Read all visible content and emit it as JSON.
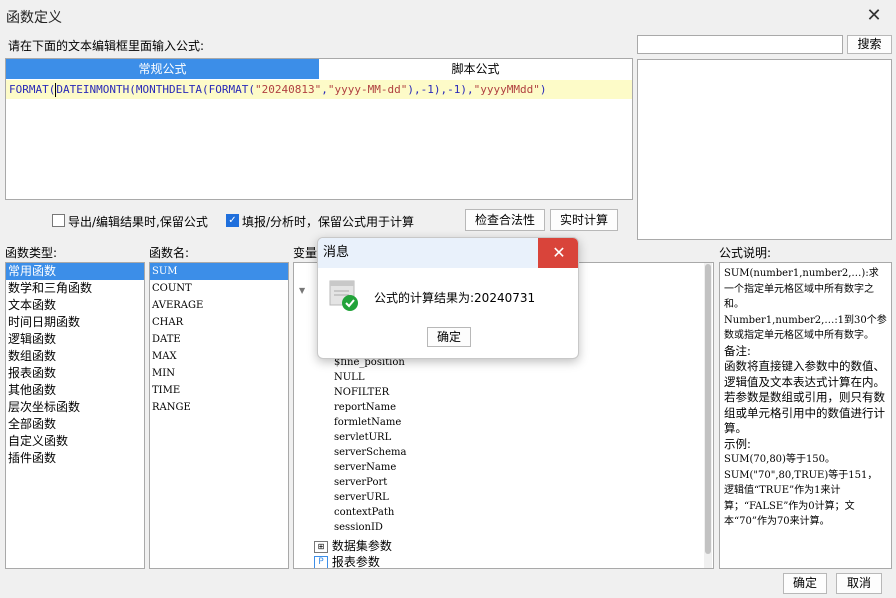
{
  "window": {
    "title": "函数定义"
  },
  "prompt": "请在下面的文本编辑框里面输入公式:",
  "search": {
    "value": "",
    "button_label": "搜索"
  },
  "editor": {
    "tabs": [
      "常规公式",
      "脚本公式"
    ],
    "formula_parts": [
      {
        "t": "FORMAT(",
        "c": "fn"
      },
      {
        "t": "DATEINMONTH(MONTHDELTA(FORMAT(",
        "c": "fn"
      },
      {
        "t": "\"20240813\"",
        "c": "str"
      },
      {
        "t": ",",
        "c": "fn"
      },
      {
        "t": "\"yyyy-MM-dd\"",
        "c": "str"
      },
      {
        "t": "),-1),-1),",
        "c": "fn"
      },
      {
        "t": "\"yyyyMMdd\"",
        "c": "str"
      },
      {
        "t": ")",
        "c": "fn"
      }
    ]
  },
  "options": {
    "export_keep": "导出/编辑结果时,保留公式",
    "fill_keep": "填报/分析时，保留公式用于计算",
    "check_button": "检查合法性",
    "realtime_button": "实时计算"
  },
  "sections": {
    "types_label": "函数类型:",
    "names_label": "函数名:",
    "vars_label": "变量",
    "desc_label": "公式说明:"
  },
  "function_types": [
    "常用函数",
    "数学和三角函数",
    "文本函数",
    "时间日期函数",
    "逻辑函数",
    "数组函数",
    "报表函数",
    "其他函数",
    "层次坐标函数",
    "全部函数",
    "自定义函数",
    "插件函数"
  ],
  "function_names": [
    "SUM",
    "COUNT",
    "AVERAGE",
    "CHAR",
    "DATE",
    "MAX",
    "MIN",
    "TIME",
    "RANGE"
  ],
  "variables": [
    "$fine_position",
    "NULL",
    "NOFILTER",
    "reportName",
    "formletName",
    "servletURL",
    "serverSchema",
    "serverName",
    "serverPort",
    "serverURL",
    "contextPath",
    "sessionID"
  ],
  "variable_nodes": [
    "数据集参数",
    "报表参数"
  ],
  "description": {
    "lines": [
      {
        "t": "SUM(number1,number2,…):求一个指定单元格区域中所有数字之和。",
        "mono": true
      },
      {
        "t": "Number1,number2,…:1到30个参数或指定单元格区域中所有数字。",
        "mono": true
      },
      {
        "t": "备注:",
        "mono": false
      },
      {
        "t": "函数将直接键入参数中的数值、逻辑值及文本表达式计算在内。若参数是数组或引用，则只有数组或单元格引用中的数值进行计算。",
        "mono": false
      },
      {
        "t": "示例:",
        "mono": false
      },
      {
        "t": "SUM(70,80)等于150。",
        "mono": true
      },
      {
        "t": "SUM(\"70\",80,TRUE)等于151，逻辑值“TRUE”作为1来计算；“FALSE”作为0计算；文本“70”作为70来计算。",
        "mono": true
      }
    ]
  },
  "footer": {
    "ok": "确定",
    "cancel": "取消"
  },
  "dialog": {
    "title": "消息",
    "message": "公式的计算结果为:20240731",
    "ok": "确定"
  }
}
